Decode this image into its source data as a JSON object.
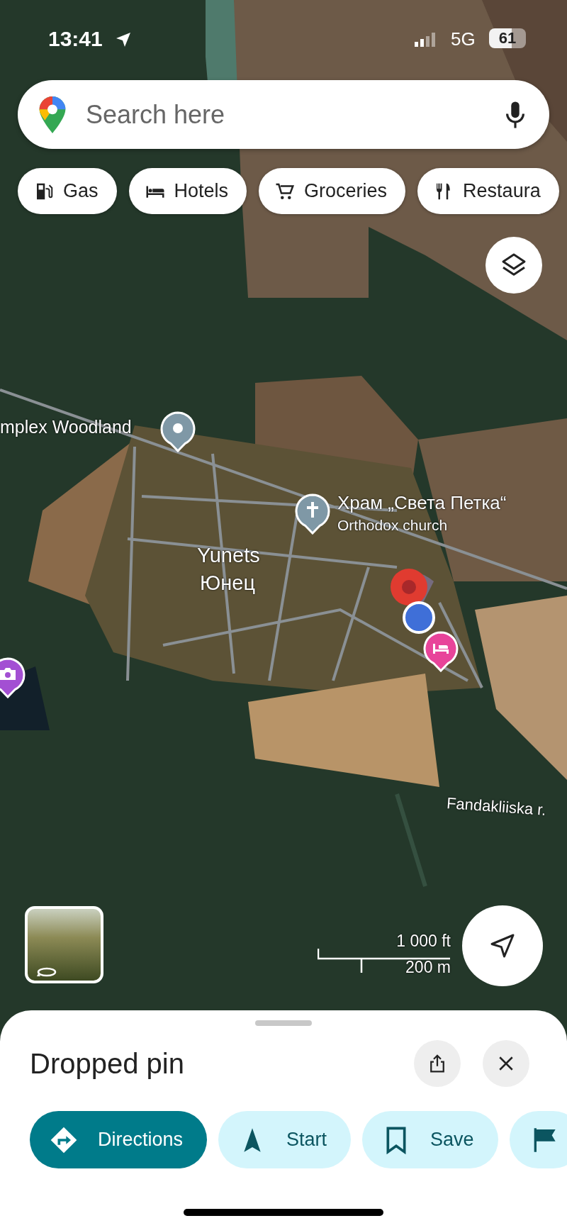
{
  "status_bar": {
    "time": "13:41",
    "network": "5G",
    "battery": "61"
  },
  "search": {
    "placeholder": "Search here"
  },
  "chips": [
    {
      "kind": "gas",
      "label": "Gas"
    },
    {
      "kind": "hotels",
      "label": "Hotels"
    },
    {
      "kind": "groceries",
      "label": "Groceries"
    },
    {
      "kind": "restaurants",
      "label": "Restaura"
    }
  ],
  "map": {
    "woodland": {
      "name": "mplex Woodland"
    },
    "church": {
      "name": "Храм „Света Петка“",
      "category": "Orthodox church"
    },
    "town": {
      "name": "Yunets",
      "local_name": "Юнец"
    },
    "river": {
      "name": "Fandakliiska r."
    }
  },
  "scale": {
    "imperial": "1 000 ft",
    "metric": "200 m"
  },
  "place": {
    "title": "Dropped pin"
  },
  "actions": [
    {
      "kind": "directions",
      "label": "Directions"
    },
    {
      "kind": "start",
      "label": "Start"
    },
    {
      "kind": "save",
      "label": "Save"
    },
    {
      "kind": "flag"
    }
  ]
}
